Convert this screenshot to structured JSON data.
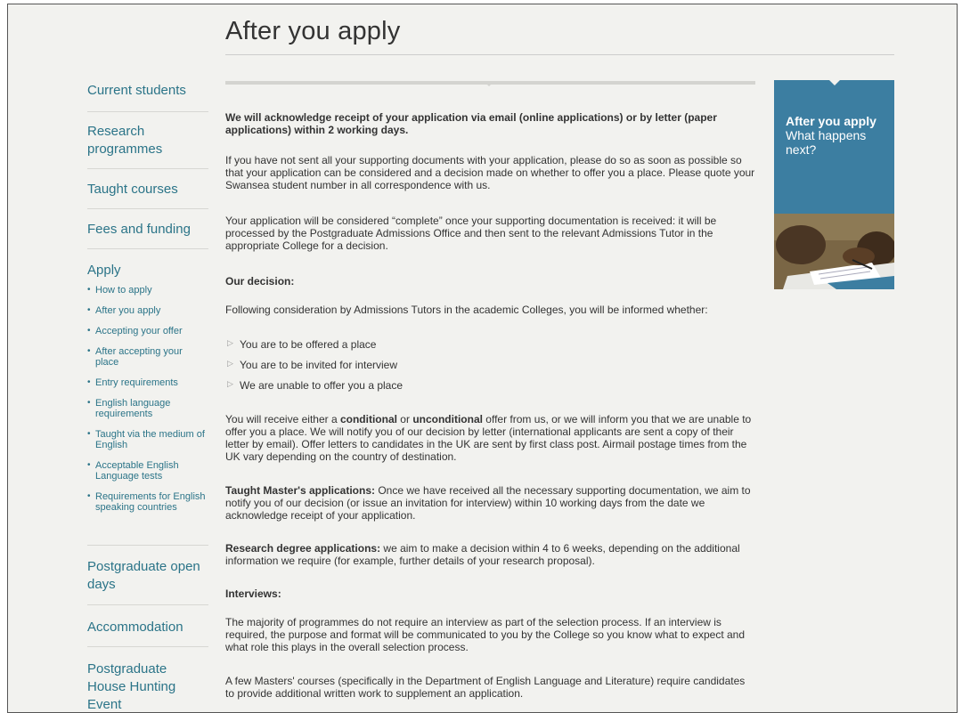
{
  "page": {
    "title": "After you apply"
  },
  "sidebar": {
    "items": [
      {
        "label": "Current students"
      },
      {
        "label": "Research programmes"
      },
      {
        "label": "Taught courses"
      },
      {
        "label": "Fees and funding"
      },
      {
        "label": "Apply"
      },
      {
        "label": "Postgraduate open days"
      },
      {
        "label": "Accommodation"
      },
      {
        "label": "Postgraduate House Hunting Event"
      }
    ],
    "apply_subitems": [
      "How to apply",
      "After you apply",
      "Accepting your offer",
      "After accepting your place",
      "Entry requirements",
      "English language requirements",
      "Taught via the medium of English",
      "Acceptable English Language tests",
      "Requirements for English speaking countries"
    ]
  },
  "content": {
    "intro": "We will acknowledge receipt of your application via email (online applications) or by letter (paper applications) within 2 working days.",
    "para1": "If you have not sent all your supporting documents with your application, please do so as soon as possible so that your application can be considered and a decision made on whether to offer you a place. Please quote your Swansea student number in all correspondence with us.",
    "para2": "Your application will be considered “complete” once your supporting documentation is received: it will be processed by the Postgraduate Admissions Office and then sent to the relevant Admissions Tutor in the appropriate College for a decision.",
    "decision_heading": "Our decision:",
    "decision_intro": "Following consideration by Admissions Tutors in the academic Colleges, you will be informed whether:",
    "choices": [
      "You are to be offered a place",
      "You are to be invited for interview",
      "We are unable to offer you a place"
    ],
    "offer_para": {
      "a": "You will receive either a ",
      "b": "conditional",
      "c": " or ",
      "d": "unconditional",
      "e": " offer from us, or we will inform you that we are unable to offer you a place. We will notify you of our decision by letter (international applicants are sent a copy of their letter by email). Offer letters to candidates in the UK are sent by first class post. Airmail postage times from the UK vary depending on the country of destination."
    },
    "taught_para": {
      "label": "Taught Master's applications:",
      "text": " Once we have received all the necessary supporting documentation, we aim to notify you of our decision (or issue an invitation for interview) within 10 working days from the date we acknowledge receipt of your application."
    },
    "research_para": {
      "label": "Research degree applications:",
      "text": " we aim to make a decision within 4 to 6 weeks, depending on the additional information we require (for example, further details of your research proposal)."
    },
    "interviews_heading": "Interviews:",
    "interviews_para": "The majority of programmes do not require an interview as part of the selection process. If an interview is required, the purpose and format will be communicated to you by the College so you know what to expect and what role this plays in the overall selection process.",
    "masters_para": "A few Masters' courses (specifically in the Department of English Language and Literature) require candidates to provide additional written work to supplement an application."
  },
  "promo": {
    "title": "After you apply",
    "subtitle": "What happens next?",
    "image_icon": "student-writing-photo"
  },
  "colors": {
    "link": "#2b7488",
    "promo_bg": "#3c7ea1",
    "page_bg": "#f2f2ef"
  }
}
